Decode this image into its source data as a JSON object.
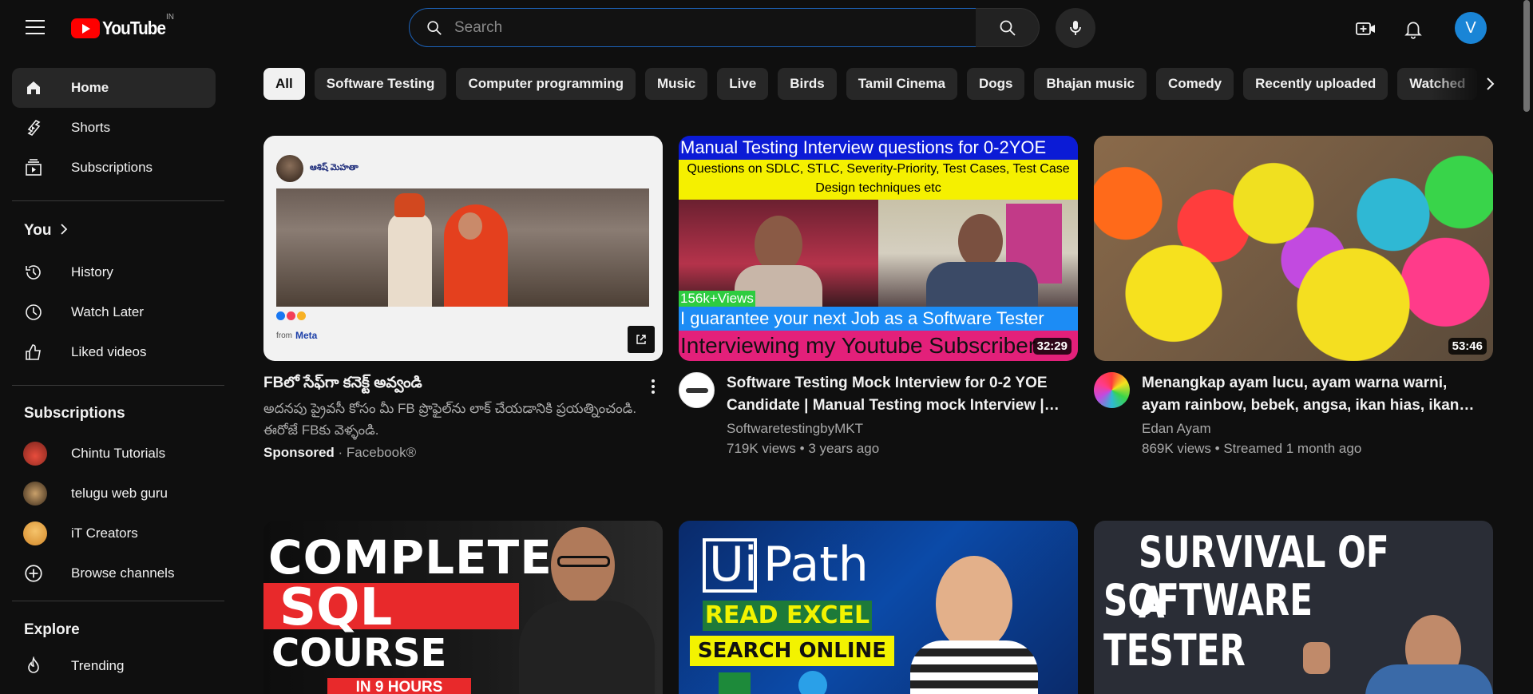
{
  "header": {
    "logo_text": "YouTube",
    "country_code": "IN",
    "search_placeholder": "Search",
    "avatar_initial": "V"
  },
  "sidebar": {
    "main": [
      {
        "label": "Home",
        "icon": "home-icon",
        "active": true
      },
      {
        "label": "Shorts",
        "icon": "shorts-icon"
      },
      {
        "label": "Subscriptions",
        "icon": "subscriptions-icon"
      }
    ],
    "you_title": "You",
    "you_items": [
      {
        "label": "History",
        "icon": "history-icon"
      },
      {
        "label": "Watch Later",
        "icon": "watch-later-icon"
      },
      {
        "label": "Liked videos",
        "icon": "thumbs-up-icon"
      }
    ],
    "subscriptions_title": "Subscriptions",
    "subscriptions": [
      {
        "label": "Chintu Tutorials",
        "color": "#c0392b"
      },
      {
        "label": "telugu web guru",
        "color": "#5a4632"
      },
      {
        "label": "iT Creators",
        "color": "#e0a030"
      },
      {
        "label": "Browse channels",
        "icon": "add-circle-icon"
      }
    ],
    "explore_title": "Explore",
    "explore_items": [
      {
        "label": "Trending",
        "icon": "flame-icon"
      }
    ]
  },
  "chips": [
    "All",
    "Software Testing",
    "Computer programming",
    "Music",
    "Live",
    "Birds",
    "Tamil Cinema",
    "Dogs",
    "Bhajan music",
    "Comedy",
    "Recently uploaded",
    "Watched"
  ],
  "videos": [
    {
      "title": "FBలో సేఫ్‌గా కనెక్ట్ అవ్వండి",
      "description": "అదనపు ప్రైవసీ కోసం మీ FB ప్రొఫైల్‌ను లాక్ చేయడానికి ప్రయత్నించండి. ఈరోజే FBకు వెళ్ళండి.",
      "sponsored": "Sponsored",
      "advertiser": "Facebook®",
      "ad_page_name": "ఆశిష్ మెహతా",
      "ad_footer": "from",
      "ad_brand": "Meta"
    },
    {
      "title": "Software Testing Mock Interview for 0-2 YOE Candidate | Manual Testing mock Interview |…",
      "channel": "SoftwaretestingbyMKT",
      "meta": "719K views • 3 years ago",
      "duration": "32:29",
      "thumb_line1": "Manual Testing Interview questions for 0-2YOE",
      "thumb_line2": "Questions on SDLC, STLC, Severity-Priority, Test Cases, Test Case Design techniques etc",
      "thumb_views": "156k+Views",
      "thumb_line3": "I guarantee your next Job as a Software Tester",
      "thumb_line4": "Interviewing my Youtube Subscriber"
    },
    {
      "title": "Menangkap ayam lucu, ayam warna warni, ayam rainbow, bebek, angsa, ikan hias, ikan…",
      "channel": "Edan Ayam",
      "meta": "869K views • Streamed 1 month ago",
      "duration": "53:46"
    }
  ],
  "row2": [
    {
      "line1": "COMPLETE",
      "line2": "SQL",
      "line3": "COURSE",
      "line4": "IN 9 HOURS"
    },
    {
      "brand_ui": "Ui",
      "brand_path": "Path",
      "line1": "READ EXCEL",
      "line2": "SEARCH ONLINE"
    },
    {
      "line1": "SURVIVAL OF A",
      "line2": "SOFTWARE TESTER"
    }
  ],
  "colors": {
    "background": "#0f0f0f",
    "youtube_red": "#ff0000",
    "chip_bg": "#272727",
    "search_border": "#1c62b9",
    "avatar_blue": "#1a85d6"
  }
}
